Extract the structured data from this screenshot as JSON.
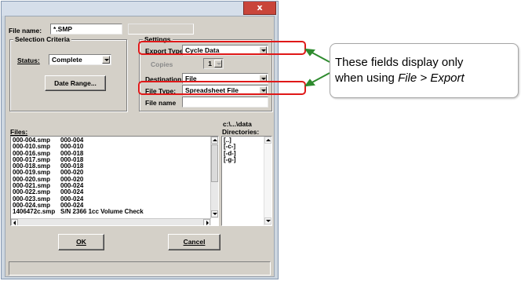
{
  "window": {
    "close_glyph": "x"
  },
  "file_name": {
    "label": "File name:",
    "value": "*.SMP"
  },
  "selection_criteria": {
    "title": "Selection Criteria",
    "status_label": "Status:",
    "status_value": "Complete",
    "date_range_button": "Date Range..."
  },
  "settings": {
    "title": "Settings",
    "export_type_label": "Export Type",
    "export_type_value": "Cycle Data",
    "copies_label": "Copies",
    "copies_value": "1",
    "destination_label": "Destination",
    "destination_value": "File",
    "file_type_label": "File Type:",
    "file_type_value": "Spreadsheet File",
    "file_name_label": "File name"
  },
  "files": {
    "label": "Files:",
    "rows": [
      [
        "000-004.smp",
        "000-004"
      ],
      [
        "000-010.smp",
        "000-010"
      ],
      [
        "000-016.smp",
        "000-018"
      ],
      [
        "000-017.smp",
        "000-018"
      ],
      [
        "000-018.smp",
        "000-018"
      ],
      [
        "000-019.smp",
        "000-020"
      ],
      [
        "000-020.smp",
        "000-020"
      ],
      [
        "000-021.smp",
        "000-024"
      ],
      [
        "000-022.smp",
        "000-024"
      ],
      [
        "000-023.smp",
        "000-024"
      ],
      [
        "000-024.smp",
        "000-024"
      ],
      [
        "1406472c.smp",
        "S/N 2366 1cc Volume Check"
      ]
    ]
  },
  "directories": {
    "path": "c:\\...\\data",
    "label": "Directories:",
    "items": [
      "[..]",
      "[-c-]",
      "[-d-]",
      "[-g-]"
    ]
  },
  "buttons": {
    "ok": "OK",
    "cancel": "Cancel"
  },
  "callout": {
    "line1": "These fields display only",
    "line2_prefix": "when using ",
    "line2_italic": "File > Export"
  },
  "colors": {
    "highlight": "#e01818",
    "arrow": "#2e8b2e"
  }
}
